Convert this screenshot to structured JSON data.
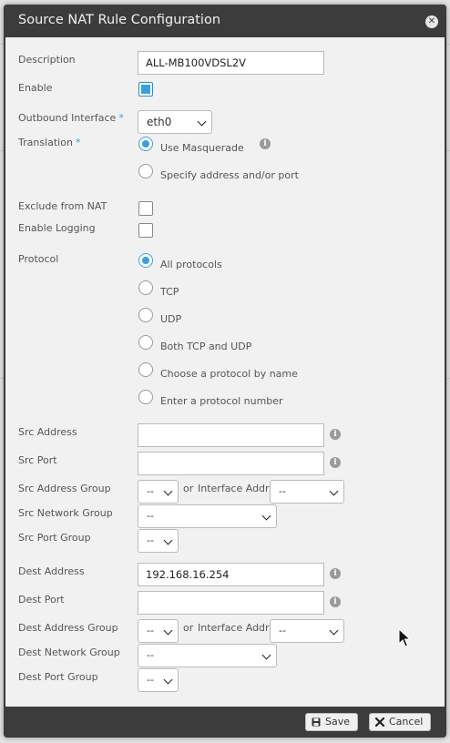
{
  "dialog": {
    "title": "Source NAT Rule Configuration",
    "close_glyph": "✕"
  },
  "form": {
    "description": {
      "label": "Description",
      "value": "ALL-MB100VDSL2V"
    },
    "enable": {
      "label": "Enable",
      "checked": true
    },
    "outbound_interface": {
      "label": "Outbound Interface",
      "required_mark": "*",
      "value": "eth0"
    },
    "translation": {
      "label": "Translation",
      "required_mark": "*",
      "options": [
        "Use Masquerade",
        "Specify address and/or port"
      ],
      "selected": "Use Masquerade"
    },
    "exclude_from_nat": {
      "label": "Exclude from NAT",
      "checked": false
    },
    "enable_logging": {
      "label": "Enable Logging",
      "checked": false
    },
    "protocol": {
      "label": "Protocol",
      "options": [
        "All protocols",
        "TCP",
        "UDP",
        "Both TCP and UDP",
        "Choose a protocol by name",
        "Enter a protocol number"
      ],
      "selected": "All protocols"
    },
    "src_address": {
      "label": "Src Address",
      "value": ""
    },
    "src_port": {
      "label": "Src Port",
      "value": ""
    },
    "src_address_group": {
      "label": "Src Address Group",
      "value": "--",
      "or_text": "or",
      "interface_label": "Interface Addr",
      "interface_value": "--"
    },
    "src_network_group": {
      "label": "Src Network Group",
      "value": "--"
    },
    "src_port_group": {
      "label": "Src Port Group",
      "value": "--"
    },
    "dest_address": {
      "label": "Dest Address",
      "value": "192.168.16.254"
    },
    "dest_port": {
      "label": "Dest Port",
      "value": ""
    },
    "dest_address_group": {
      "label": "Dest Address Group",
      "value": "--",
      "or_text": "or",
      "interface_label": "Interface Addr",
      "interface_value": "--"
    },
    "dest_network_group": {
      "label": "Dest Network Group",
      "value": "--"
    },
    "dest_port_group": {
      "label": "Dest Port Group",
      "value": "--"
    }
  },
  "footer": {
    "save_label": "Save",
    "cancel_label": "Cancel"
  },
  "icons": {
    "info": "i",
    "save": "floppy-disk-icon",
    "cancel": "x-icon"
  },
  "colors": {
    "accent": "#3aa0dc",
    "titlebar": "#3c3c3c",
    "body": "#f1f1f1"
  }
}
